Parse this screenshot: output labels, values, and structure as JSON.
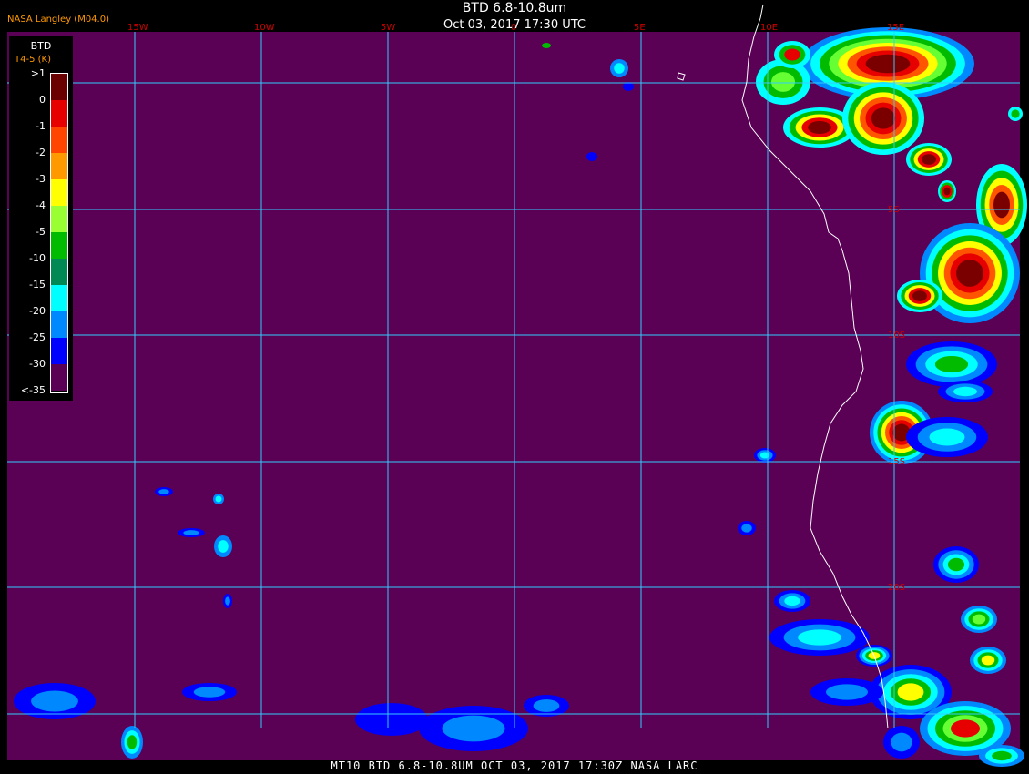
{
  "header": {
    "credit": "NASA Langley (M04.0)",
    "title": "BTD 6.8-10.8um",
    "subtitle": "Oct 03, 2017 17:30 UTC"
  },
  "footer": {
    "text": "MT10  BTD 6.8-10.8UM  OCT 03, 2017 17:30Z  NASA LARC"
  },
  "legend": {
    "title": "BTD",
    "subtitle": "T4-5 (K)",
    "labels": [
      ">1",
      "0",
      "-1",
      "-2",
      "-3",
      "-4",
      "-5",
      "-10",
      "-15",
      "-20",
      "-25",
      "-30",
      "<-35"
    ],
    "colors": [
      "#6b0000",
      "#e60000",
      "#ff4500",
      "#ff9900",
      "#ffff00",
      "#99ff33",
      "#00bb00",
      "#008855",
      "#00ffff",
      "#0088ff",
      "#0000ff",
      "#5a0055"
    ]
  },
  "map": {
    "background_color": "#5a0055",
    "grid_color": "#33ccff",
    "coast_color": "#ffffff",
    "lon_labels": [
      "15W",
      "10W",
      "5W",
      "0",
      "5E",
      "10E",
      "15E"
    ],
    "lat_labels": [
      "5S",
      "10S",
      "15S",
      "20S"
    ]
  }
}
